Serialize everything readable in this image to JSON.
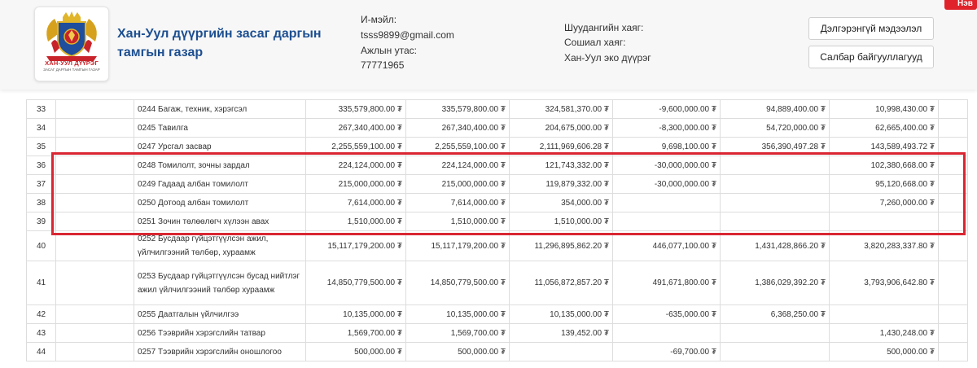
{
  "header": {
    "logo": {
      "icon": "khan-uul-district-emblem",
      "text_top": "ХАН-УУЛ ДҮҮРЭГ",
      "text_bottom": "ЗАСАГ ДАРГЫН ТАМГЫН ГАЗАР"
    },
    "org_name": "Хан-Уул дүүргийн засаг даргын тамгын газар",
    "email_label": "И-мэйл:",
    "email_value": "tsss9899@gmail.com",
    "phone_label": "Ажлын утас:",
    "phone_value": "77771965",
    "website_label": "Шуудангийн хаяг:",
    "social_label": "Сошиал хаяг:",
    "social_value": "Хан-Уул эко дүүрэг",
    "more_info_button": "Дэлгэрэнгүй мэдээлэл",
    "branches_button": "Салбар байгууллагууд",
    "corner_tab": "Нэв"
  },
  "table": {
    "rows": [
      {
        "no": "33",
        "name": "0244 Багаж, техник, хэрэгсэл",
        "c1": "335,579,800.00 ₮",
        "c2": "335,579,800.00 ₮",
        "c3": "324,581,370.00 ₮",
        "c4": "-9,600,000.00 ₮",
        "c5": "94,889,400.00 ₮",
        "c6": "10,998,430.00 ₮"
      },
      {
        "no": "34",
        "name": "0245 Тавилга",
        "c1": "267,340,400.00 ₮",
        "c2": "267,340,400.00 ₮",
        "c3": "204,675,000.00 ₮",
        "c4": "-8,300,000.00 ₮",
        "c5": "54,720,000.00 ₮",
        "c6": "62,665,400.00 ₮"
      },
      {
        "no": "35",
        "name": "0247 Урсгал засвар",
        "c1": "2,255,559,100.00 ₮",
        "c2": "2,255,559,100.00 ₮",
        "c3": "2,111,969,606.28 ₮",
        "c4": "9,698,100.00 ₮",
        "c5": "356,390,497.28 ₮",
        "c6": "143,589,493.72 ₮"
      },
      {
        "no": "36",
        "name": "0248 Томилолт, зочны зардал",
        "c1": "224,124,000.00 ₮",
        "c2": "224,124,000.00 ₮",
        "c3": "121,743,332.00 ₮",
        "c4": "-30,000,000.00 ₮",
        "c5": "",
        "c6": "102,380,668.00 ₮"
      },
      {
        "no": "37",
        "name": "0249 Гадаад албан томилолт",
        "c1": "215,000,000.00 ₮",
        "c2": "215,000,000.00 ₮",
        "c3": "119,879,332.00 ₮",
        "c4": "-30,000,000.00 ₮",
        "c5": "",
        "c6": "95,120,668.00 ₮"
      },
      {
        "no": "38",
        "name": "0250 Дотоод албан томилолт",
        "c1": "7,614,000.00 ₮",
        "c2": "7,614,000.00 ₮",
        "c3": "354,000.00 ₮",
        "c4": "",
        "c5": "",
        "c6": "7,260,000.00 ₮"
      },
      {
        "no": "39",
        "name": "0251 Зочин төлөөлөгч хүлээн авах",
        "c1": "1,510,000.00 ₮",
        "c2": "1,510,000.00 ₮",
        "c3": "1,510,000.00 ₮",
        "c4": "",
        "c5": "",
        "c6": ""
      },
      {
        "no": "40",
        "name": "0252 Бусдаар гүйцэтгүүлсэн ажил, үйлчилгээний төлбөр, хураамж",
        "c1": "15,117,179,200.00 ₮",
        "c2": "15,117,179,200.00 ₮",
        "c3": "11,296,895,862.20 ₮",
        "c4": "446,077,100.00 ₮",
        "c5": "1,431,428,866.20 ₮",
        "c6": "3,820,283,337.80 ₮"
      },
      {
        "no": "41",
        "name": "0253 Бусдаар гүйцэтгүүлсэн бусад нийтлэг ажил үйлчилгээний төлбөр хураамж",
        "c1": "14,850,779,500.00 ₮",
        "c2": "14,850,779,500.00 ₮",
        "c3": "11,056,872,857.20 ₮",
        "c4": "491,671,800.00 ₮",
        "c5": "1,386,029,392.20 ₮",
        "c6": "3,793,906,642.80 ₮"
      },
      {
        "no": "42",
        "name": "0255 Даатгалын үйлчилгээ",
        "c1": "10,135,000.00 ₮",
        "c2": "10,135,000.00 ₮",
        "c3": "10,135,000.00 ₮",
        "c4": "-635,000.00 ₮",
        "c5": "6,368,250.00 ₮",
        "c6": ""
      },
      {
        "no": "43",
        "name": "0256 Тээврийн хэрэгслийн татвар",
        "c1": "1,569,700.00 ₮",
        "c2": "1,569,700.00 ₮",
        "c3": "139,452.00 ₮",
        "c4": "",
        "c5": "",
        "c6": "1,430,248.00 ₮"
      },
      {
        "no": "44",
        "name": "0257 Тээврийн хэрэгслийн оношлогоо",
        "c1": "500,000.00 ₮",
        "c2": "500,000.00 ₮",
        "c3": "",
        "c4": "-69,700.00 ₮",
        "c5": "",
        "c6": "500,000.00 ₮"
      }
    ]
  },
  "colors": {
    "org_name": "#1d4f91",
    "highlight_box": "#d92632",
    "corner_tab": "#e0232a"
  }
}
